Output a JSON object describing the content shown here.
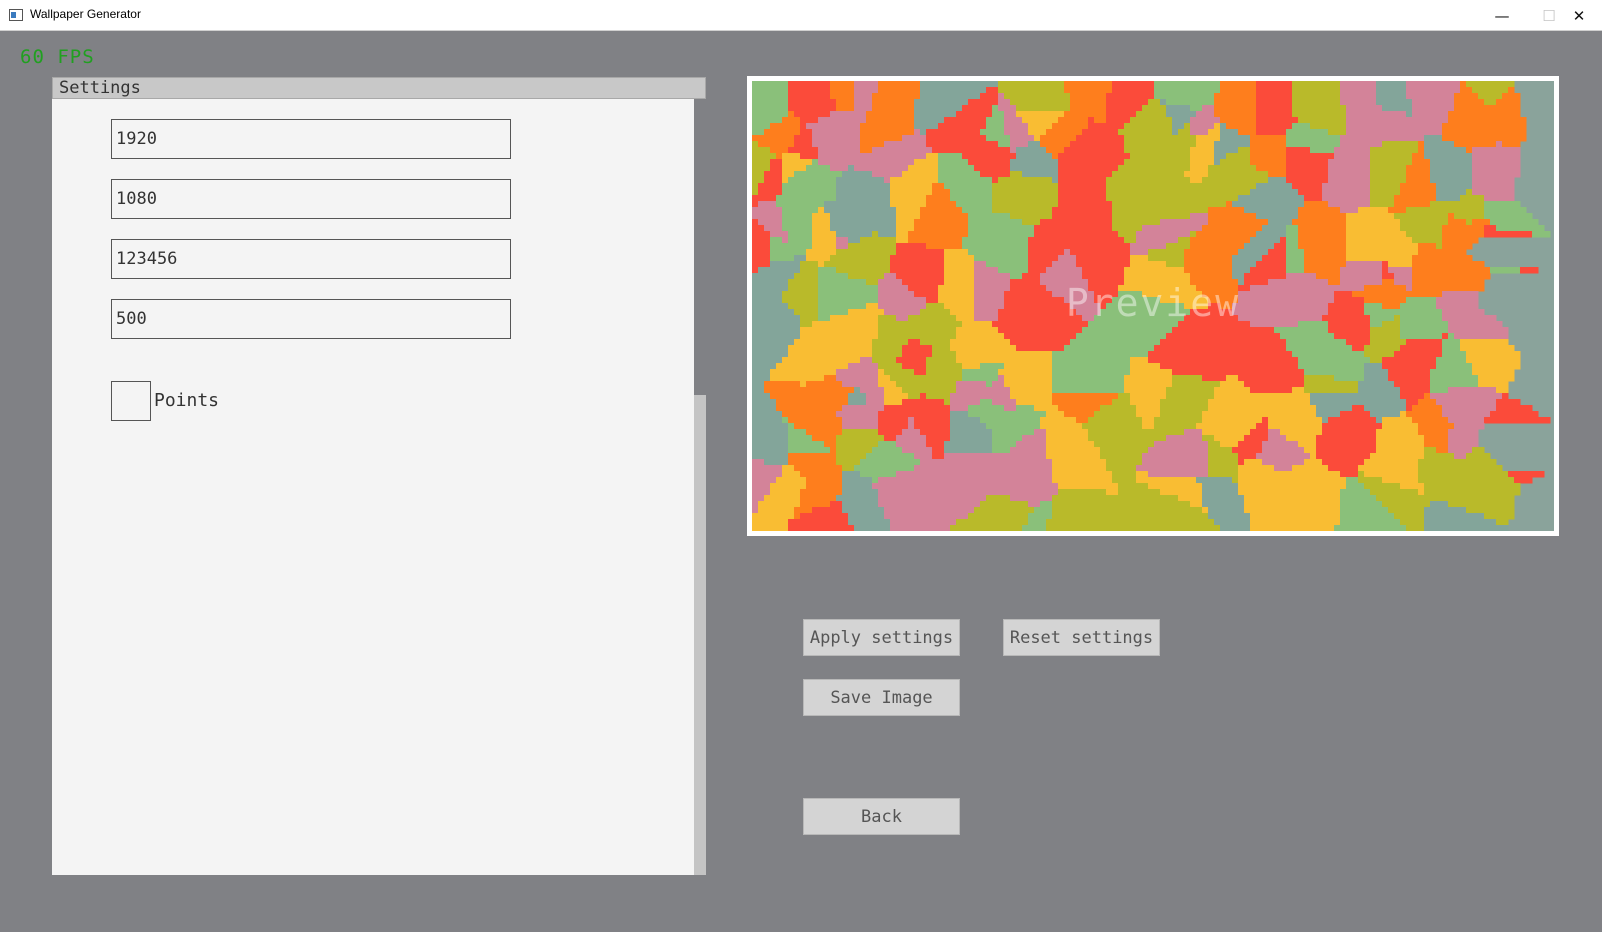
{
  "window": {
    "title": "Wallpaper Generator",
    "minimize_glyph": "—",
    "maximize_glyph": "☐",
    "close_glyph": "✕"
  },
  "fps": {
    "text": "60 FPS",
    "color": "#20a020"
  },
  "settings": {
    "title": "Settings",
    "width_value": "1920",
    "height_value": "1080",
    "seed_value": "123456",
    "points_count_value": "500",
    "show_points_label": "Points",
    "show_points_checked": false
  },
  "preview": {
    "label": "Preview",
    "palette": [
      "#f9bd33",
      "#fe7e1d",
      "#fb4b3a",
      "#d38399",
      "#b9ba2a",
      "#8ac07a",
      "#83a59a"
    ]
  },
  "buttons": {
    "apply": "Apply settings",
    "reset": "Reset settings",
    "save": "Save Image",
    "back": "Back"
  }
}
